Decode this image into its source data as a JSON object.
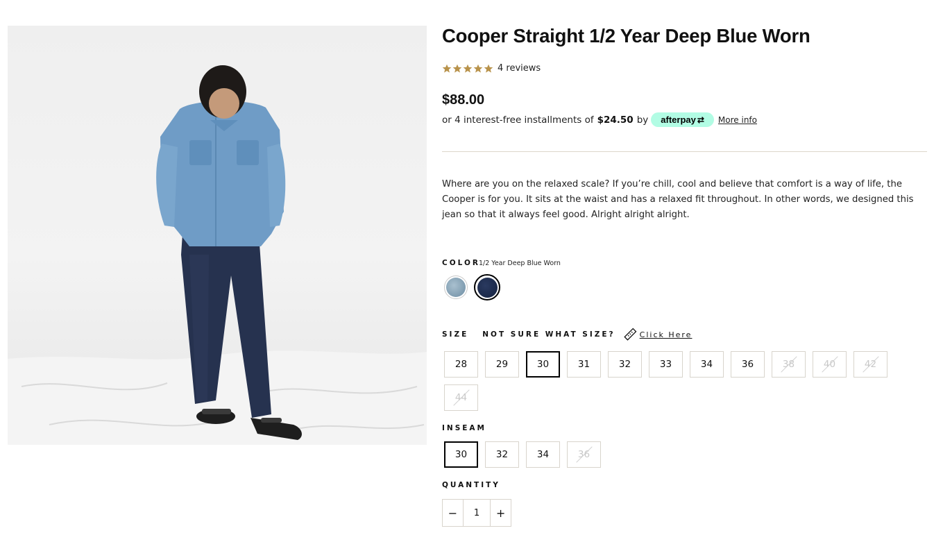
{
  "product": {
    "title": "Cooper Straight 1/2 Year Deep Blue Worn",
    "rating": 5,
    "reviews_label": "4 reviews",
    "price": "$88.00",
    "installments_prefix": "or 4 interest-free installments of",
    "installment_amount": "$24.50",
    "installments_by": "by",
    "afterpay_label": "afterpay",
    "more_info_label": "More info",
    "description": "Where are you on the relaxed scale? If you’re chill, cool and believe that comfort is a way of life, the Cooper is for you. It sits at the waist and has a relaxed fit throughout. In other words, we designed this jean so that it always feel good. Alright alright alright."
  },
  "color": {
    "label": "COLOR",
    "selected_value": "1/2 Year Deep Blue Worn",
    "swatches": [
      {
        "name": "light-wash",
        "color": "#7f9cb0",
        "selected": false
      },
      {
        "name": "deep-blue-worn",
        "color": "#1c2a4a",
        "selected": true
      }
    ]
  },
  "size": {
    "label": "SIZE",
    "help_label": "NOT SURE WHAT SIZE?",
    "click_here_label": "Click Here",
    "options": [
      {
        "label": "28",
        "state": "available"
      },
      {
        "label": "29",
        "state": "available"
      },
      {
        "label": "30",
        "state": "selected"
      },
      {
        "label": "31",
        "state": "available"
      },
      {
        "label": "32",
        "state": "available"
      },
      {
        "label": "33",
        "state": "available"
      },
      {
        "label": "34",
        "state": "available"
      },
      {
        "label": "36",
        "state": "available"
      },
      {
        "label": "38",
        "state": "disabled"
      },
      {
        "label": "40",
        "state": "disabled"
      },
      {
        "label": "42",
        "state": "disabled"
      },
      {
        "label": "44",
        "state": "disabled"
      }
    ]
  },
  "inseam": {
    "label": "INSEAM",
    "options": [
      {
        "label": "30",
        "state": "selected"
      },
      {
        "label": "32",
        "state": "available"
      },
      {
        "label": "34",
        "state": "available"
      },
      {
        "label": "36",
        "state": "disabled"
      }
    ]
  },
  "quantity": {
    "label": "QUANTITY",
    "minus": "−",
    "value": "1",
    "plus": "+"
  },
  "colors": {
    "star": "#b8924a",
    "afterpay_mint": "#b2fce4",
    "divider": "#dcd6cb"
  }
}
